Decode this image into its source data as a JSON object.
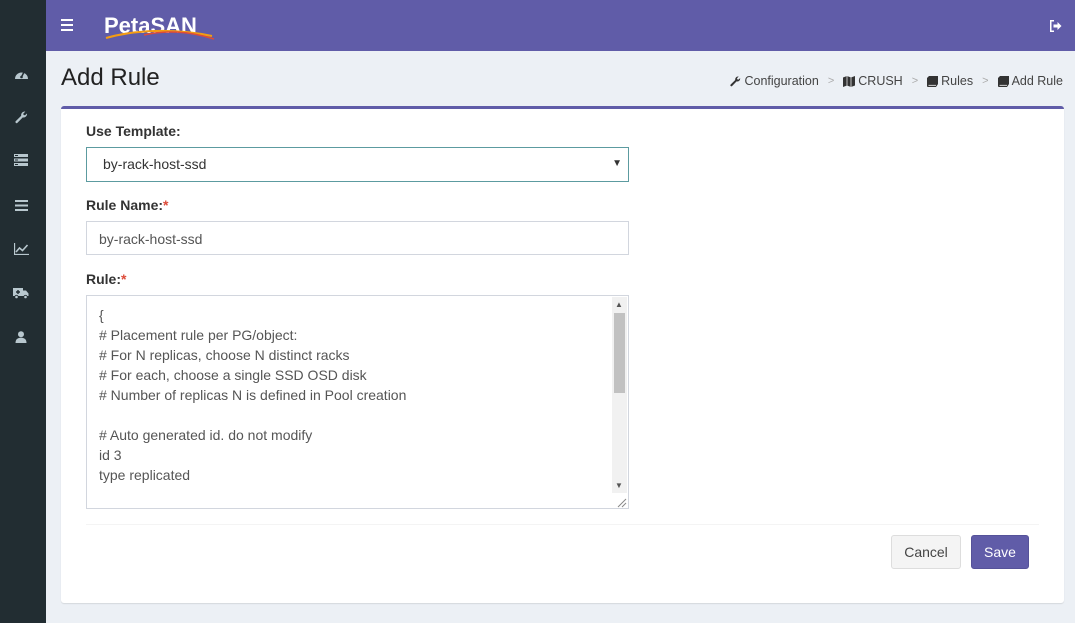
{
  "app": {
    "logo_text": "PetaSAN"
  },
  "colors": {
    "accent": "#605ca8",
    "sidebar": "#222d32",
    "required": "#dd4b39"
  },
  "sidebar": {
    "items": [
      {
        "icon": "dashboard-icon"
      },
      {
        "icon": "wrench-icon"
      },
      {
        "icon": "server-icon"
      },
      {
        "icon": "list-icon"
      },
      {
        "icon": "chart-icon"
      },
      {
        "icon": "ambulance-icon"
      },
      {
        "icon": "user-icon"
      }
    ]
  },
  "page": {
    "title": "Add Rule"
  },
  "breadcrumb": {
    "items": [
      {
        "label": "Configuration",
        "icon": "wrench-icon"
      },
      {
        "label": "CRUSH",
        "icon": "map-icon"
      },
      {
        "label": "Rules",
        "icon": "book-icon"
      },
      {
        "label": "Add Rule",
        "icon": "book-icon"
      }
    ],
    "separator": ">"
  },
  "form": {
    "template_label": "Use Template:",
    "template_value": "by-rack-host-ssd",
    "rule_name_label": "Rule Name:",
    "rule_name_value": "by-rack-host-ssd",
    "rule_label": "Rule:",
    "required_mark": "*",
    "rule_text": "{\n# Placement rule per PG/object:\n# For N replicas, choose N distinct racks\n# For each, choose a single SSD OSD disk\n# Number of replicas N is defined in Pool creation\n\n# Auto generated id. do not modify\nid 3\ntype replicated\n\n# Min and max replica the rule is defined for. Each"
  },
  "actions": {
    "cancel_label": "Cancel",
    "save_label": "Save"
  }
}
